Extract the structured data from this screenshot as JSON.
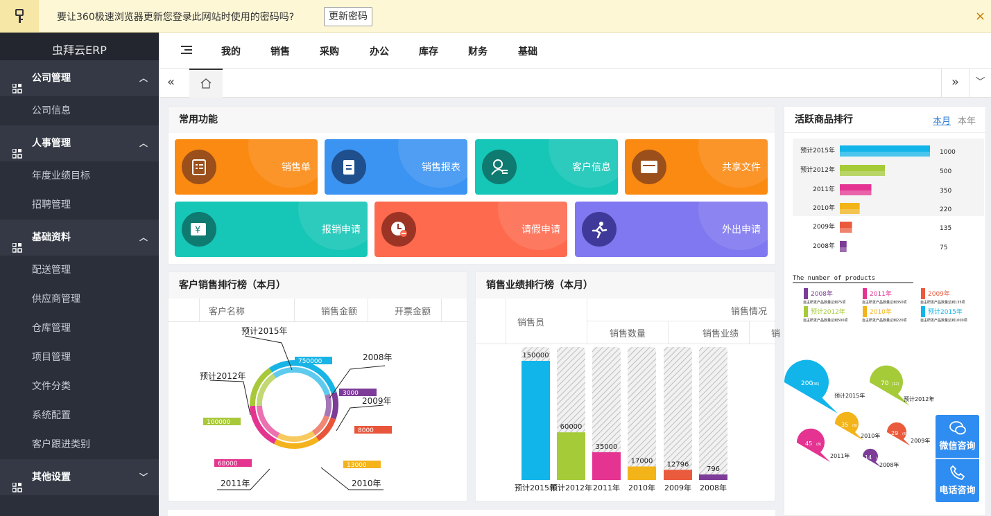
{
  "infobar": {
    "message": "要让360极速浏览器更新您登录此网站时使用的密码吗?",
    "update_button": "更新密码",
    "close": "×"
  },
  "sidebar": {
    "brand": "虫拜云ERP",
    "sections": [
      {
        "label": "公司管理",
        "items": [
          "公司信息"
        ]
      },
      {
        "label": "人事管理",
        "items": [
          "年度业绩目标",
          "招聘管理"
        ]
      },
      {
        "label": "基础资料",
        "items": [
          "配送管理",
          "供应商管理",
          "仓库管理",
          "项目管理",
          "文件分类",
          "系统配置",
          "客户跟进类别"
        ]
      },
      {
        "label": "其他设置",
        "items": []
      }
    ]
  },
  "topnav": {
    "items": [
      "我的",
      "销售",
      "采购",
      "办公",
      "库存",
      "财务",
      "基础"
    ]
  },
  "quick": {
    "title": "常用功能",
    "tiles": [
      "销售单",
      "销售报表",
      "客户信息",
      "共享文件",
      "报销申请",
      "请假申请",
      "外出申请"
    ]
  },
  "colors": {
    "orange": "#fb8a12",
    "blue": "#3b93f2",
    "teal": "#16c6b7",
    "red": "#fd6a4e",
    "purple": "#7f78f0"
  },
  "customer_rank": {
    "title": "客户销售排行榜（本月）",
    "columns": [
      "客户名称",
      "销售金额",
      "开票金额"
    ]
  },
  "sales_rank": {
    "title": "销售业绩排行榜（本月）",
    "col_person": "销售员",
    "col_group": "销售情况",
    "columns": [
      "销售数量",
      "销售业绩"
    ],
    "partial": "销"
  },
  "active_goods": {
    "title": "活跃商品排行",
    "tab_month": "本月",
    "tab_year": "本年"
  },
  "chart_data": [
    {
      "type": "pie",
      "categories": [
        "预计2015年",
        "2008年",
        "2009年",
        "2010年",
        "2011年",
        "预计2012年"
      ],
      "values": [
        750000,
        3000,
        8000,
        13000,
        68000,
        100000
      ],
      "colors": [
        "#19b4e6",
        "#7d3c98",
        "#e8553a",
        "#f4b31c",
        "#e4348f",
        "#a8c83a"
      ]
    },
    {
      "type": "bar",
      "categories": [
        "预计2015年",
        "预计2012年",
        "2011年",
        "2010年",
        "2009年",
        "2008年"
      ],
      "values": [
        150000,
        60000,
        35000,
        17000,
        12796,
        796
      ],
      "value_labels": [
        "150000",
        "60000",
        "35000",
        "17000",
        "12796",
        "796"
      ],
      "colors": [
        "#12b5ea",
        "#a5cb38",
        "#e43391",
        "#f3b41a",
        "#ea5a3c",
        "#7d3c98"
      ]
    },
    {
      "type": "bar",
      "orientation": "horizontal",
      "categories": [
        "预计2015年",
        "预计2012年",
        "2011年",
        "2010年",
        "2009年",
        "2008年"
      ],
      "values": [
        1000,
        500,
        350,
        220,
        135,
        75
      ],
      "colors": [
        "#12b5ea",
        "#a5cb38",
        "#e43391",
        "#f3b41a",
        "#ea5a3c",
        "#7d3c98"
      ],
      "note": "The number of products",
      "legend": [
        {
          "name": "2008年",
          "desc": "自主研发产品数量达到75项"
        },
        {
          "name": "2009年",
          "desc": "自主研发产品数量达到135项"
        },
        {
          "name": "2010年",
          "desc": "自主研发产品数量达到220项"
        },
        {
          "name": "2011年",
          "desc": "自主研发产品数量达到350项"
        },
        {
          "name": "预计2012年",
          "desc": "自主研发产品数量达到500项"
        },
        {
          "name": "预计2015年",
          "desc": "自主研发产品数量达到1000项"
        }
      ]
    },
    {
      "type": "scatter",
      "categories": [
        "预计2015年",
        "预计2012年",
        "2010年",
        "2009年",
        "2011年",
        "2008年"
      ],
      "values": [
        200,
        70,
        35,
        29,
        45,
        14
      ],
      "counts": [
        "(36)",
        "(12)",
        "(6)",
        "(6)",
        "(8)",
        "(4)"
      ],
      "colors": [
        "#12b5ea",
        "#a5cb38",
        "#f3b41a",
        "#ea5a3c",
        "#e43391",
        "#7d3c98"
      ]
    }
  ],
  "float_buttons": {
    "wechat": "微信咨询",
    "phone": "电话咨询"
  }
}
